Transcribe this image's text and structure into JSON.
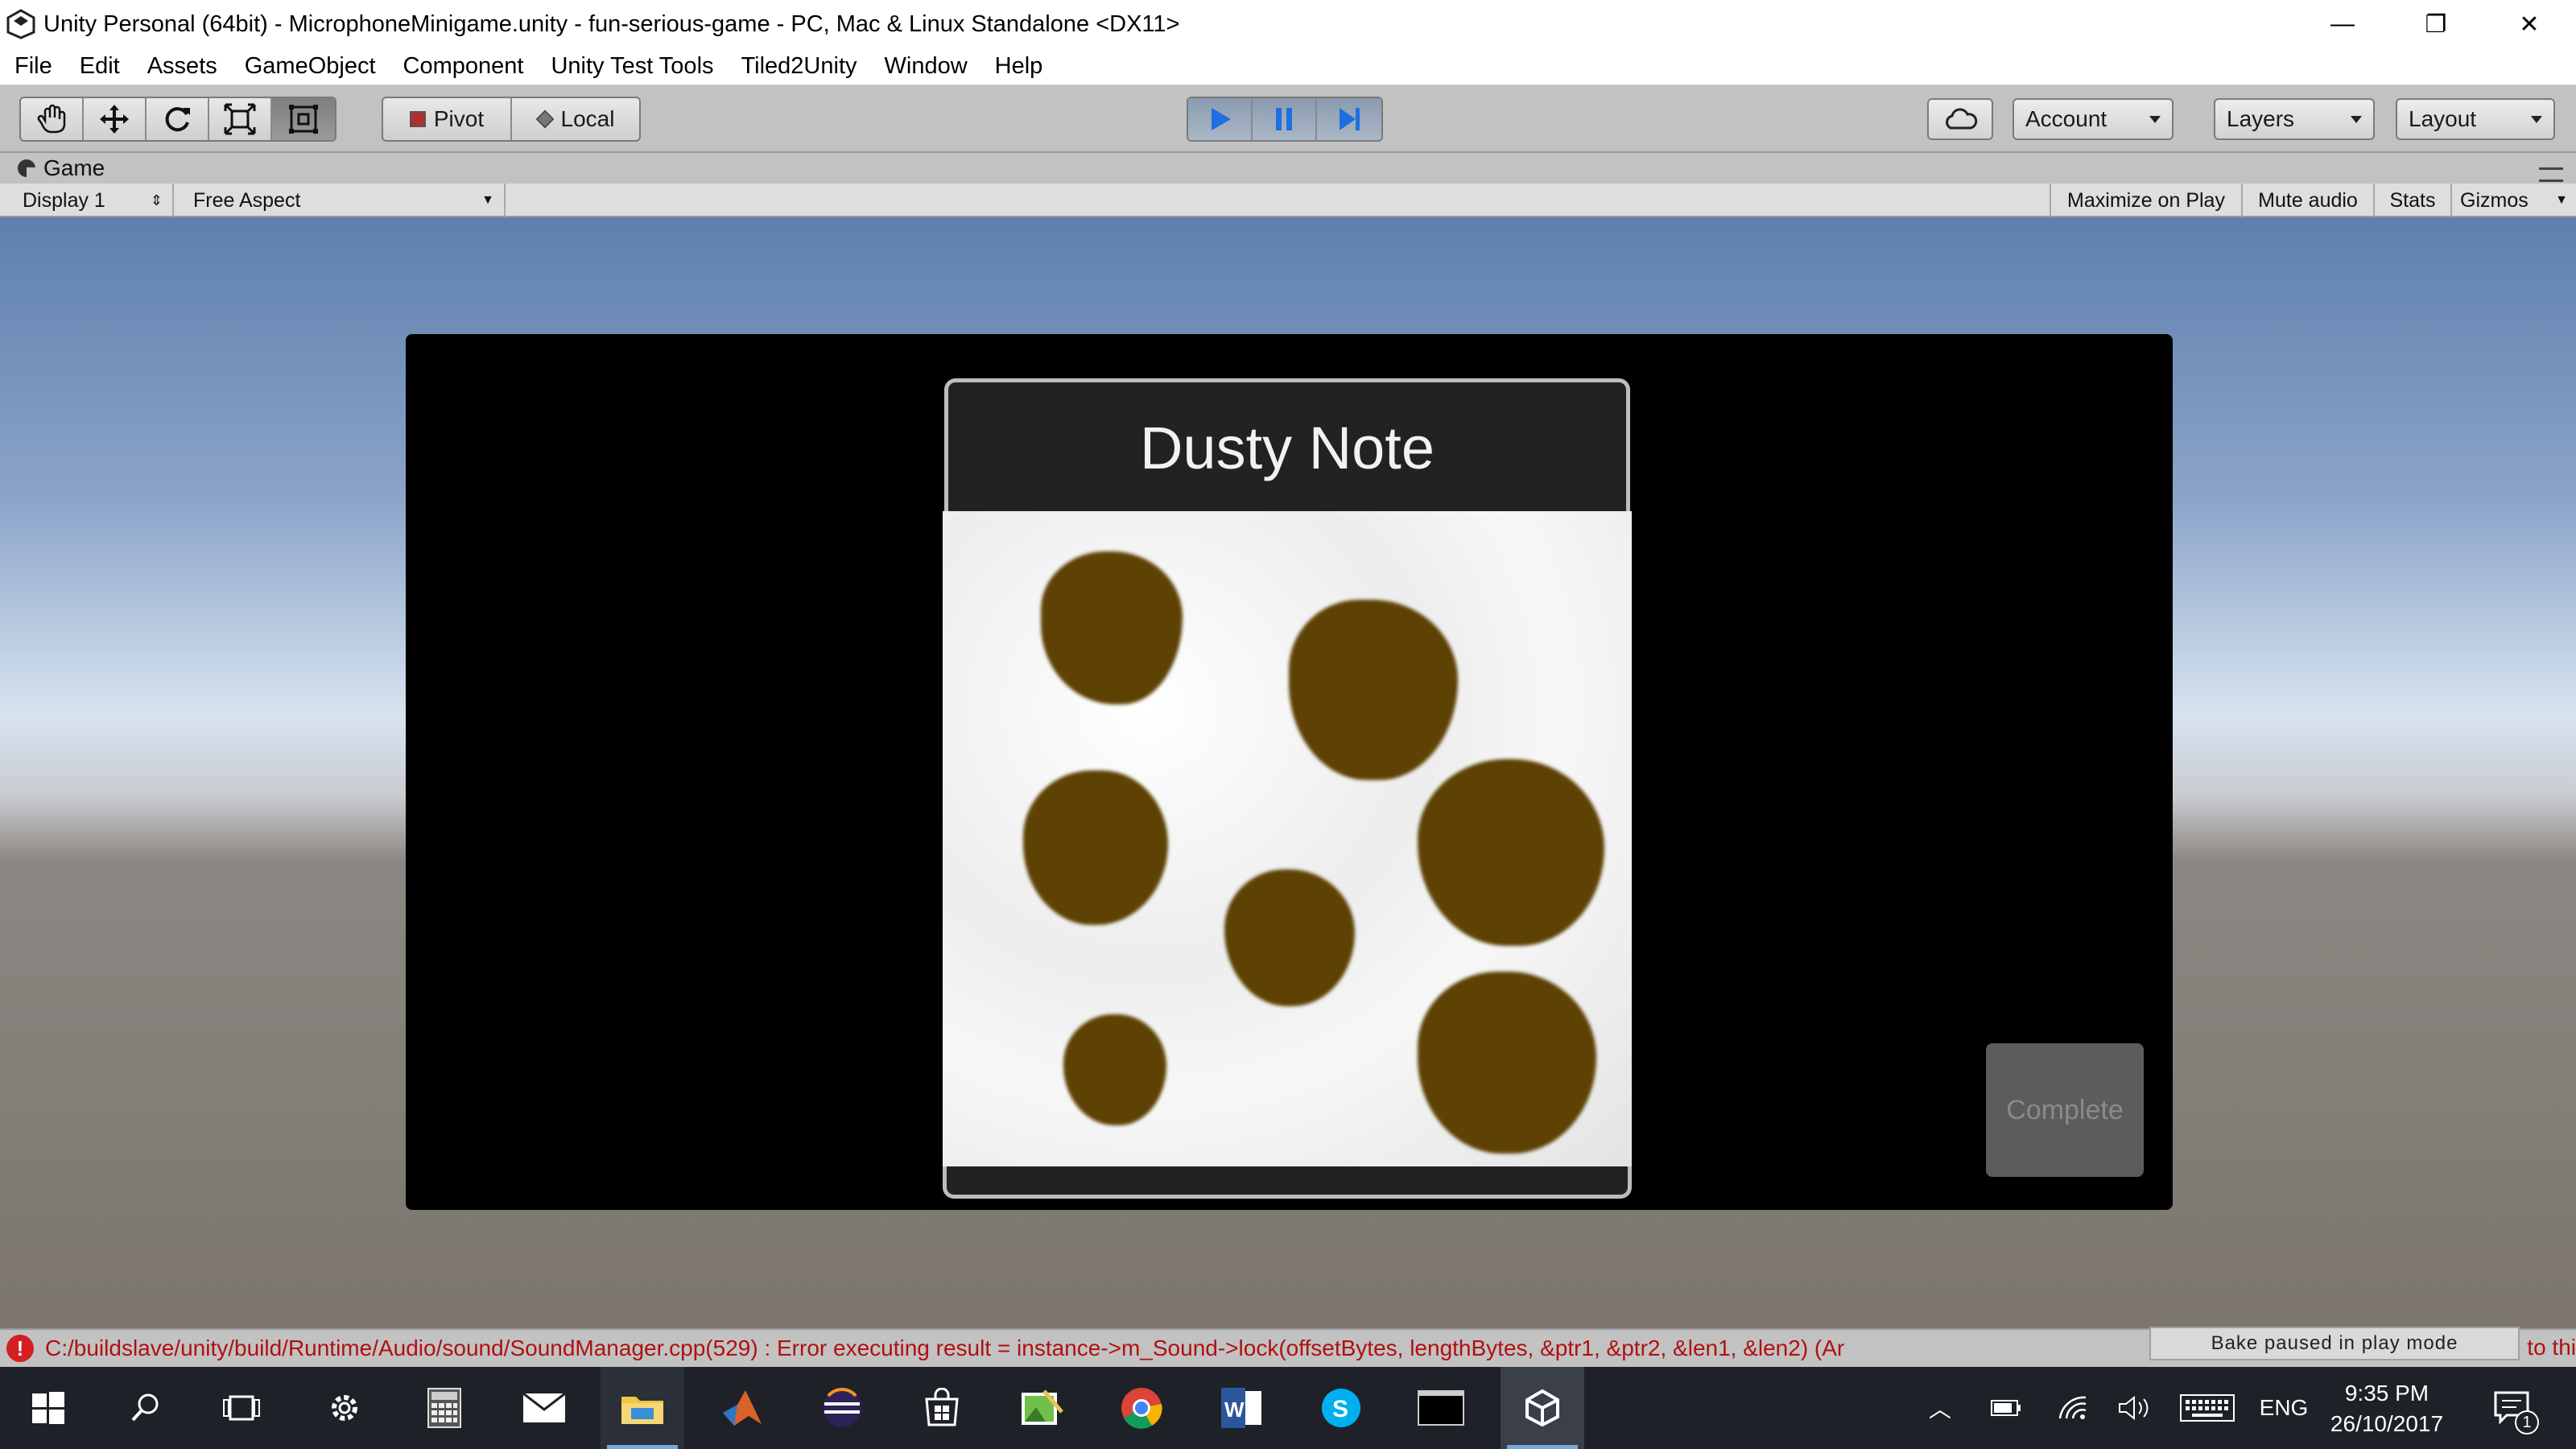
{
  "window": {
    "title": "Unity Personal (64bit) - MicrophoneMinigame.unity - fun-serious-game - PC, Mac & Linux Standalone <DX11>",
    "minimize": "—",
    "restore": "❐",
    "close": "✕"
  },
  "menu": [
    "File",
    "Edit",
    "Assets",
    "GameObject",
    "Component",
    "Unity Test Tools",
    "Tiled2Unity",
    "Window",
    "Help"
  ],
  "toolbar": {
    "tools": [
      "hand-icon",
      "move-icon",
      "rotate-icon",
      "scale-icon",
      "rect-tool-icon"
    ],
    "pivot_label": "Pivot",
    "local_label": "Local",
    "account_label": "Account",
    "layers_label": "Layers",
    "layout_label": "Layout",
    "play_state": "playing",
    "accent": "#3a7bd5"
  },
  "game_panel": {
    "tab_label": "Game",
    "display_label": "Display 1",
    "aspect_label": "Free Aspect",
    "maximize_label": "Maximize on Play",
    "mute_label": "Mute audio",
    "stats_label": "Stats",
    "gizmos_label": "Gizmos"
  },
  "game": {
    "note_title": "Dusty Note",
    "complete_label": "Complete",
    "dust_color": "#5e4204"
  },
  "status": {
    "error_icon": "!",
    "error_text": "C:/buildslave/unity/build/Runtime/Audio/sound/SoundManager.cpp(529) : Error executing result = instance->m_Sound->lock(offsetBytes, lengthBytes, &ptr1, &ptr2, &len1, &len2) (Ar",
    "error_tail": "to thi",
    "bake_text": "Bake paused in play mode"
  },
  "taskbar": {
    "apps": [
      "windows-start-icon",
      "search-icon",
      "task-view-icon",
      "settings-icon",
      "calculator-icon",
      "mail-icon",
      "file-explorer-icon",
      "matlab-icon",
      "eclipse-icon",
      "store-icon",
      "photos-icon",
      "chrome-icon",
      "word-icon",
      "skype-icon",
      "terminal-icon",
      "unity-icon"
    ],
    "language": "ENG",
    "time": "9:35 PM",
    "date": "26/10/2017",
    "notification_count": "1"
  }
}
